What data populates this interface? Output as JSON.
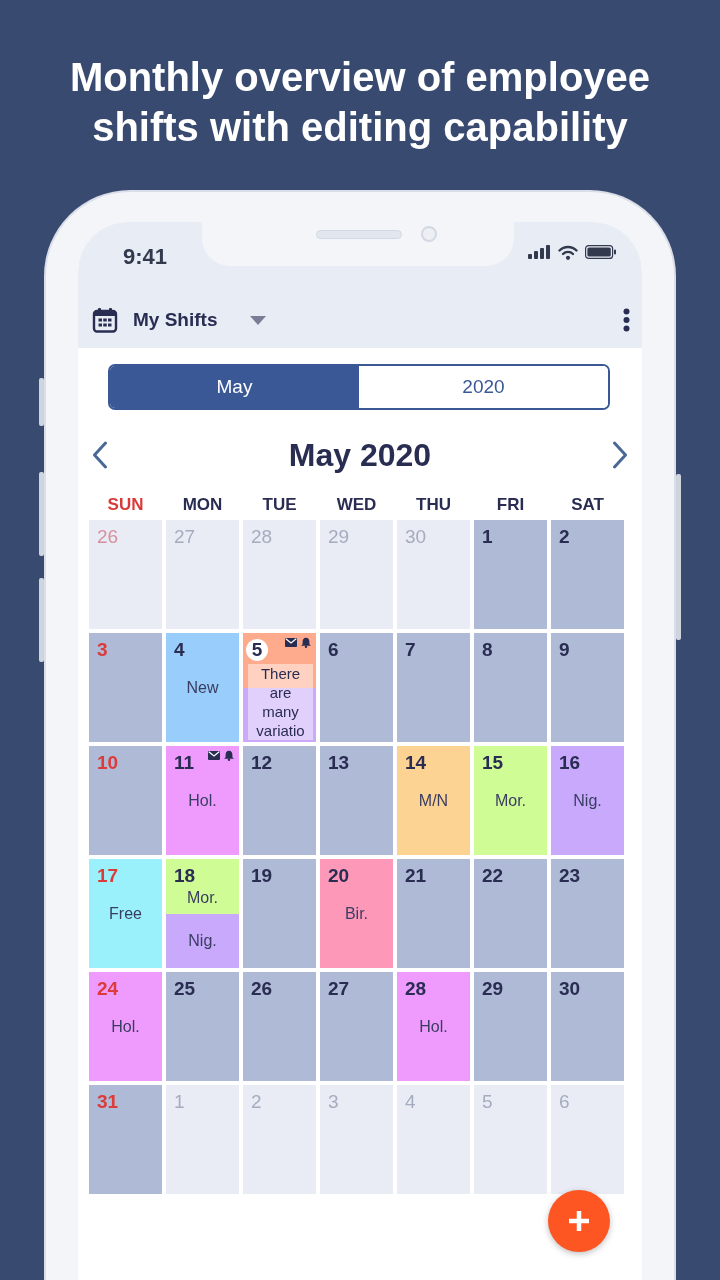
{
  "headline": "Monthly overview of employee shifts with editing capability",
  "status_bar": {
    "time": "9:41"
  },
  "app_bar": {
    "title": "My Shifts"
  },
  "view_toggle": [
    {
      "label": "May",
      "selected": true
    },
    {
      "label": "2020",
      "selected": false
    }
  ],
  "month_nav": {
    "title": "May 2020"
  },
  "weekdays": [
    {
      "label": "SUN",
      "highlighted": true
    },
    {
      "label": "MON",
      "highlighted": false
    },
    {
      "label": "TUE",
      "highlighted": false
    },
    {
      "label": "WED",
      "highlighted": false
    },
    {
      "label": "THU",
      "highlighted": false
    },
    {
      "label": "FRI",
      "highlighted": false
    },
    {
      "label": "SAT",
      "highlighted": false
    }
  ],
  "weeks": [
    {
      "days": [
        {
          "day": "26",
          "in_month": false,
          "today": false,
          "mail": false,
          "alarm": false
        },
        {
          "day": "27",
          "in_month": false,
          "today": false,
          "mail": false,
          "alarm": false
        },
        {
          "day": "28",
          "in_month": false,
          "today": false,
          "mail": false,
          "alarm": false
        },
        {
          "day": "29",
          "in_month": false,
          "today": false,
          "mail": false,
          "alarm": false
        },
        {
          "day": "30",
          "in_month": false,
          "today": false,
          "mail": false,
          "alarm": false
        },
        {
          "day": "1",
          "in_month": true,
          "today": false,
          "mail": false,
          "alarm": false
        },
        {
          "day": "2",
          "in_month": true,
          "today": false,
          "mail": false,
          "alarm": false
        }
      ]
    },
    {
      "days": [
        {
          "day": "3",
          "in_month": true,
          "today": false,
          "mail": false,
          "alarm": false
        },
        {
          "day": "4",
          "in_month": true,
          "today": false,
          "mail": false,
          "alarm": false,
          "shifts": [
            {
              "label": "New",
              "color": "#99cdfb"
            }
          ]
        },
        {
          "day": "5",
          "in_month": true,
          "today": true,
          "mail": true,
          "alarm": true,
          "shifts": [
            {
              "color": "#fdab8c"
            },
            {
              "color": "#cba9f9"
            }
          ],
          "note": "There are many variatio"
        },
        {
          "day": "6",
          "in_month": true,
          "today": false,
          "mail": false,
          "alarm": false
        },
        {
          "day": "7",
          "in_month": true,
          "today": false,
          "mail": false,
          "alarm": false
        },
        {
          "day": "8",
          "in_month": true,
          "today": false,
          "mail": false,
          "alarm": false
        },
        {
          "day": "9",
          "in_month": true,
          "today": false,
          "mail": false,
          "alarm": false
        }
      ]
    },
    {
      "days": [
        {
          "day": "10",
          "in_month": true,
          "today": false,
          "mail": false,
          "alarm": false
        },
        {
          "day": "11",
          "in_month": true,
          "today": false,
          "mail": true,
          "alarm": true,
          "shifts": [
            {
              "label": "Hol.",
              "color": "#ef9bfd"
            }
          ]
        },
        {
          "day": "12",
          "in_month": true,
          "today": false,
          "mail": false,
          "alarm": false
        },
        {
          "day": "13",
          "in_month": true,
          "today": false,
          "mail": false,
          "alarm": false
        },
        {
          "day": "14",
          "in_month": true,
          "today": false,
          "mail": false,
          "alarm": false,
          "shifts": [
            {
              "label": "M/N",
              "color": "#fdd393"
            }
          ]
        },
        {
          "day": "15",
          "in_month": true,
          "today": false,
          "mail": false,
          "alarm": false,
          "shifts": [
            {
              "label": "Mor.",
              "color": "#d0fc96"
            }
          ]
        },
        {
          "day": "16",
          "in_month": true,
          "today": false,
          "mail": false,
          "alarm": false,
          "shifts": [
            {
              "label": "Nig.",
              "color": "#c8a9fc"
            }
          ]
        }
      ]
    },
    {
      "days": [
        {
          "day": "17",
          "in_month": true,
          "today": false,
          "mail": false,
          "alarm": false,
          "shifts": [
            {
              "label": "Free",
              "color": "#9af1fc"
            }
          ]
        },
        {
          "day": "18",
          "in_month": true,
          "today": false,
          "mail": false,
          "alarm": false,
          "shifts": [
            {
              "label": "Mor.",
              "color": "#d0fc96"
            },
            {
              "label": "Nig.",
              "color": "#c8a9fc"
            }
          ]
        },
        {
          "day": "19",
          "in_month": true,
          "today": false,
          "mail": false,
          "alarm": false
        },
        {
          "day": "20",
          "in_month": true,
          "today": false,
          "mail": false,
          "alarm": false,
          "shifts": [
            {
              "label": "Bir.",
              "color": "#fd98b9"
            }
          ]
        },
        {
          "day": "21",
          "in_month": true,
          "today": false,
          "mail": false,
          "alarm": false
        },
        {
          "day": "22",
          "in_month": true,
          "today": false,
          "mail": false,
          "alarm": false
        },
        {
          "day": "23",
          "in_month": true,
          "today": false,
          "mail": false,
          "alarm": false
        }
      ]
    },
    {
      "days": [
        {
          "day": "24",
          "in_month": true,
          "today": false,
          "mail": false,
          "alarm": false,
          "shifts": [
            {
              "label": "Hol.",
              "color": "#ef9bfd"
            }
          ]
        },
        {
          "day": "25",
          "in_month": true,
          "today": false,
          "mail": false,
          "alarm": false
        },
        {
          "day": "26",
          "in_month": true,
          "today": false,
          "mail": false,
          "alarm": false
        },
        {
          "day": "27",
          "in_month": true,
          "today": false,
          "mail": false,
          "alarm": false
        },
        {
          "day": "28",
          "in_month": true,
          "today": false,
          "mail": false,
          "alarm": false,
          "shifts": [
            {
              "label": "Hol.",
              "color": "#ef9bfd"
            }
          ]
        },
        {
          "day": "29",
          "in_month": true,
          "today": false,
          "mail": false,
          "alarm": false
        },
        {
          "day": "30",
          "in_month": true,
          "today": false,
          "mail": false,
          "alarm": false
        }
      ]
    },
    {
      "days": [
        {
          "day": "31",
          "in_month": true,
          "today": false,
          "mail": false,
          "alarm": false
        },
        {
          "day": "1",
          "in_month": false,
          "today": false,
          "mail": false,
          "alarm": false
        },
        {
          "day": "2",
          "in_month": false,
          "today": false,
          "mail": false,
          "alarm": false
        },
        {
          "day": "3",
          "in_month": false,
          "today": false,
          "mail": false,
          "alarm": false
        },
        {
          "day": "4",
          "in_month": false,
          "today": false,
          "mail": false,
          "alarm": false
        },
        {
          "day": "5",
          "in_month": false,
          "today": false,
          "mail": false,
          "alarm": false
        },
        {
          "day": "6",
          "in_month": false,
          "today": false,
          "mail": false,
          "alarm": false
        }
      ]
    }
  ]
}
